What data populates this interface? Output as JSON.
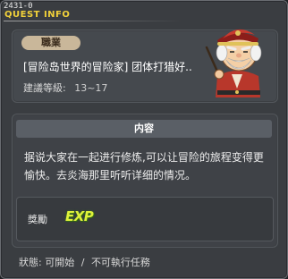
{
  "header": {
    "quest_id": "2431-0",
    "title": "QUEST INFO"
  },
  "quest": {
    "job_label": "職業",
    "name": "[冒险岛世界的冒险家] 团体打猎好..",
    "level_label": "建議等級:",
    "level_value": "13~17"
  },
  "content": {
    "header": "内容",
    "description": "据说大家在一起进行修炼,可以让冒险的旅程变得更愉快。去炎海那里听听详细的情况。"
  },
  "reward": {
    "label": "獎勵",
    "exp": "EXP"
  },
  "status": {
    "label": "狀態:",
    "start": "可開始",
    "separator": "/",
    "cannot": "不可執行任務"
  },
  "colors": {
    "title": "#f2d23a",
    "exp": "#dff23a",
    "job_badge": "#c9b79a"
  },
  "icons": {
    "npc": "npc-portrait-icon"
  }
}
